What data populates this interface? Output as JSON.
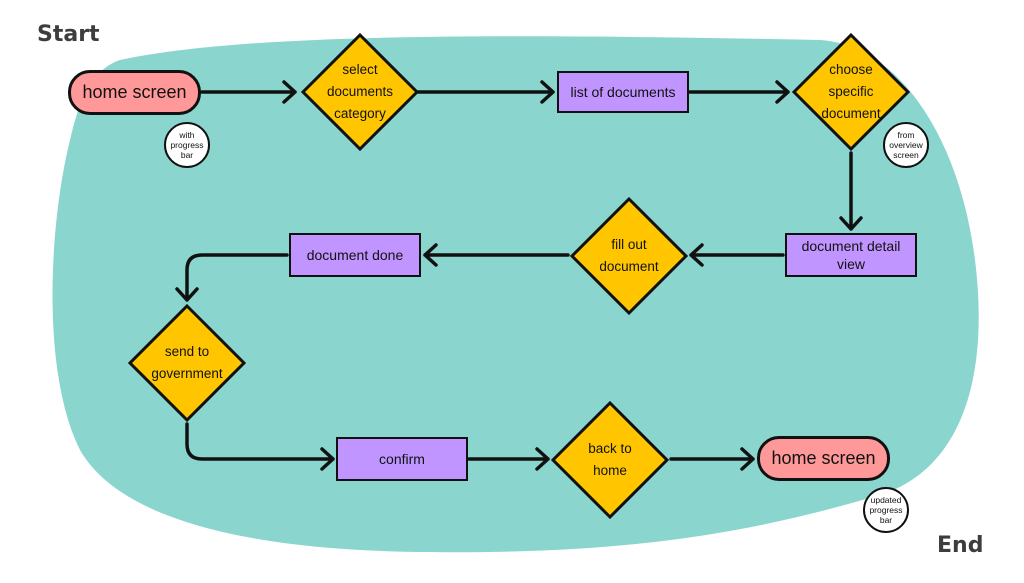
{
  "labels": {
    "start": "Start",
    "end": "End"
  },
  "colors": {
    "blob": "#8ad6cf",
    "terminal": "#ff9999",
    "process": "#c195ff",
    "decision": "#ffc600",
    "stroke": "#111111"
  },
  "nodes": {
    "home_start": {
      "type": "terminal",
      "text": "home screen"
    },
    "select_category": {
      "type": "decision",
      "lines": [
        "select",
        "documents",
        "category"
      ]
    },
    "list_documents": {
      "type": "process",
      "text": "list of documents"
    },
    "choose_document": {
      "type": "decision",
      "lines": [
        "choose",
        "specific",
        "document"
      ]
    },
    "detail_view": {
      "type": "process",
      "lines": [
        "document detail",
        "view"
      ]
    },
    "fill_out": {
      "type": "decision",
      "lines": [
        "fill out",
        "document"
      ]
    },
    "document_done": {
      "type": "process",
      "text": "document done"
    },
    "send_government": {
      "type": "decision",
      "lines": [
        "send to",
        "government"
      ]
    },
    "confirm": {
      "type": "process",
      "text": "confirm"
    },
    "back_home": {
      "type": "decision",
      "lines": [
        "back to",
        "home"
      ]
    },
    "home_end": {
      "type": "terminal",
      "text": "home screen"
    }
  },
  "notes": {
    "start_note": [
      "with",
      "progress",
      "bar"
    ],
    "choose_note": [
      "from",
      "overview",
      "screen"
    ],
    "end_note": [
      "updated",
      "progress",
      "bar"
    ]
  },
  "edges": [
    [
      "home_start",
      "select_category"
    ],
    [
      "select_category",
      "list_documents"
    ],
    [
      "list_documents",
      "choose_document"
    ],
    [
      "choose_document",
      "detail_view"
    ],
    [
      "detail_view",
      "fill_out"
    ],
    [
      "fill_out",
      "document_done"
    ],
    [
      "document_done",
      "send_government"
    ],
    [
      "send_government",
      "confirm"
    ],
    [
      "confirm",
      "back_home"
    ],
    [
      "back_home",
      "home_end"
    ]
  ]
}
